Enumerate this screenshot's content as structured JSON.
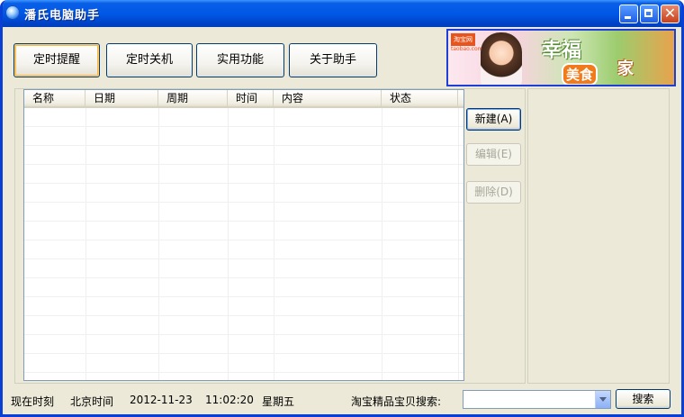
{
  "window": {
    "title": "潘氏电脑助手",
    "controls": [
      "minimize-icon",
      "maximize-icon",
      "close-icon"
    ]
  },
  "nav": {
    "buttons": [
      "定时提醒",
      "定时关机",
      "实用功能",
      "关于助手"
    ],
    "active": "定时提醒"
  },
  "banner": {
    "logo": "淘宝网",
    "logo_sub": "taobao.com",
    "slogan_line1": "幸福",
    "slogan_line2": "美食",
    "slogan_line3": "家"
  },
  "table": {
    "columns": [
      "名称",
      "日期",
      "周期",
      "时间",
      "内容",
      "状态"
    ],
    "rows": []
  },
  "actions": {
    "new_label": "新建(A)",
    "edit_label": "编辑(E)",
    "delete_label": "删除(D)"
  },
  "status": {
    "label": "现在时刻",
    "timezone": "北京时间",
    "date": "2012-11-23",
    "time": "11:02:20",
    "weekday": "星期五"
  },
  "search": {
    "label": "淘宝精品宝贝搜索:",
    "value": "",
    "button_label": "搜索"
  },
  "colors": {
    "title_bar": "#0058e6",
    "window_bg": "#ece9d8",
    "button_border": "#003c74"
  }
}
